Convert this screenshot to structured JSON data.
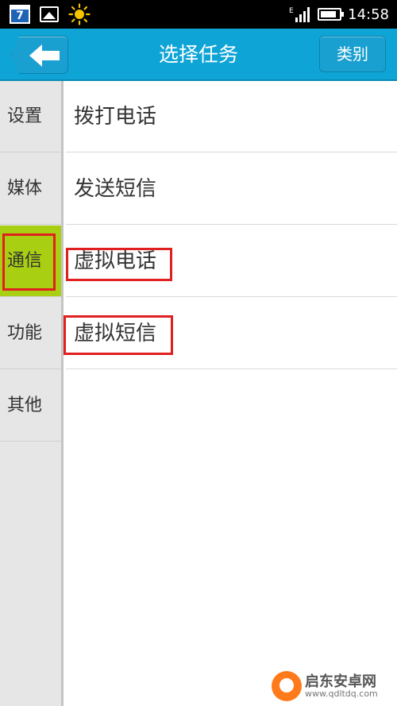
{
  "status_bar": {
    "calendar_day": "7",
    "time": "14:58",
    "battery_level": 0.85,
    "icons": [
      "calendar-icon",
      "image-icon",
      "sun-icon",
      "signal-icon",
      "battery-icon"
    ]
  },
  "header": {
    "title": "选择任务",
    "category_button": "类别",
    "back_icon": "arrow-left-icon"
  },
  "sidebar": {
    "items": [
      {
        "label": "设置"
      },
      {
        "label": "媒体"
      },
      {
        "label": "通信",
        "active": true
      },
      {
        "label": "功能"
      },
      {
        "label": "其他"
      }
    ]
  },
  "tasks": {
    "items": [
      {
        "label": "拨打电话"
      },
      {
        "label": "发送短信"
      },
      {
        "label": "虚拟电话"
      },
      {
        "label": "虚拟短信"
      }
    ]
  },
  "watermark": {
    "name": "启东安卓网",
    "url": "www.qdltdq.com"
  },
  "colors": {
    "header": "#0ea4d6",
    "active_sidebar": "#a9cf12",
    "highlight": "#e02020"
  }
}
